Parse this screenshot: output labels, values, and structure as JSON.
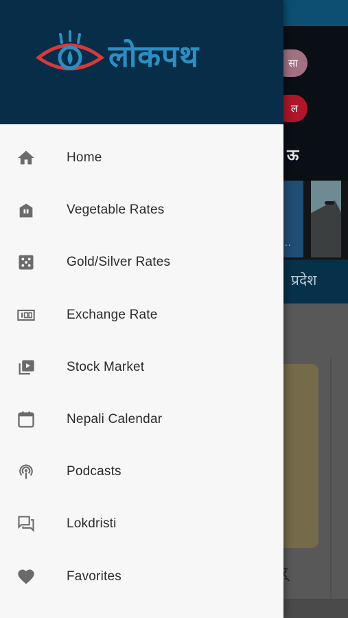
{
  "drawer": {
    "logo_text": "लोकपथ",
    "menu": [
      {
        "label": "Home",
        "icon": "home-icon"
      },
      {
        "label": "Vegetable Rates",
        "icon": "store-icon"
      },
      {
        "label": "Gold/Silver Rates",
        "icon": "dice-icon"
      },
      {
        "label": "Exchange Rate",
        "icon": "money-icon"
      },
      {
        "label": "Stock Market",
        "icon": "video-library-icon"
      },
      {
        "label": "Nepali Calendar",
        "icon": "calendar-icon"
      },
      {
        "label": "Podcasts",
        "icon": "podcast-icon"
      },
      {
        "label": "Lokdristi",
        "icon": "forum-icon"
      },
      {
        "label": "Favorites",
        "icon": "heart-icon"
      }
    ]
  },
  "background": {
    "chip_top": "सा",
    "chip_red": "ल",
    "tab_label": "प्रदेश",
    "glyph": "ऊ",
    "card_char": "र्"
  },
  "colors": {
    "drawer_header": "#082d49",
    "logo_blue": "#2c8fc3",
    "logo_red": "#d63a3a",
    "icon_gray": "#6b6b6b",
    "text_dark": "#2b2b2b"
  }
}
